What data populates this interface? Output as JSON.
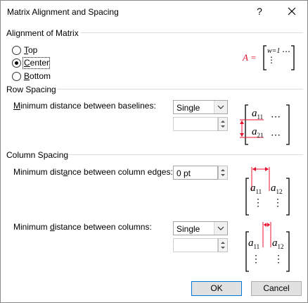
{
  "title": "Matrix Alignment and Spacing",
  "titlebar": {
    "help": "?",
    "close_icon": "close-icon"
  },
  "alignment": {
    "section_label": "Alignment of Matrix",
    "options": [
      {
        "pre": "",
        "key": "T",
        "post": "op",
        "selected": false
      },
      {
        "pre": "",
        "key": "C",
        "post": "enter",
        "selected": true
      },
      {
        "pre": "",
        "key": "B",
        "post": "ottom",
        "selected": false
      }
    ],
    "preview": {
      "lhs": "A =",
      "cell": "w=1",
      "dots": "⋯",
      "vdots": "⋮"
    }
  },
  "row_spacing": {
    "section_label": "Row Spacing",
    "baseline_label_pre": "",
    "baseline_label_key": "M",
    "baseline_label_post": "inimum distance between baselines:",
    "select_value": "Single",
    "spin_value": "",
    "preview": {
      "a": "a",
      "sub1": "11",
      "sub2": "21",
      "dots": "⋯"
    }
  },
  "column_spacing": {
    "section_label": "Column Spacing",
    "edges_label_pre": "Minimum dist",
    "edges_label_key": "a",
    "edges_label_post": "nce between column edges:",
    "edges_value": "0 pt",
    "columns_label_pre": "Minimum ",
    "columns_label_key": "d",
    "columns_label_post": "istance between columns:",
    "select_value": "Single",
    "spin_value": "",
    "preview": {
      "a": "a",
      "sub11": "11",
      "sub12": "12",
      "vdots": "⋮"
    }
  },
  "buttons": {
    "ok": "OK",
    "cancel": "Cancel"
  },
  "colors": {
    "accent": "#0078d7",
    "annotation": "#e8112d"
  }
}
